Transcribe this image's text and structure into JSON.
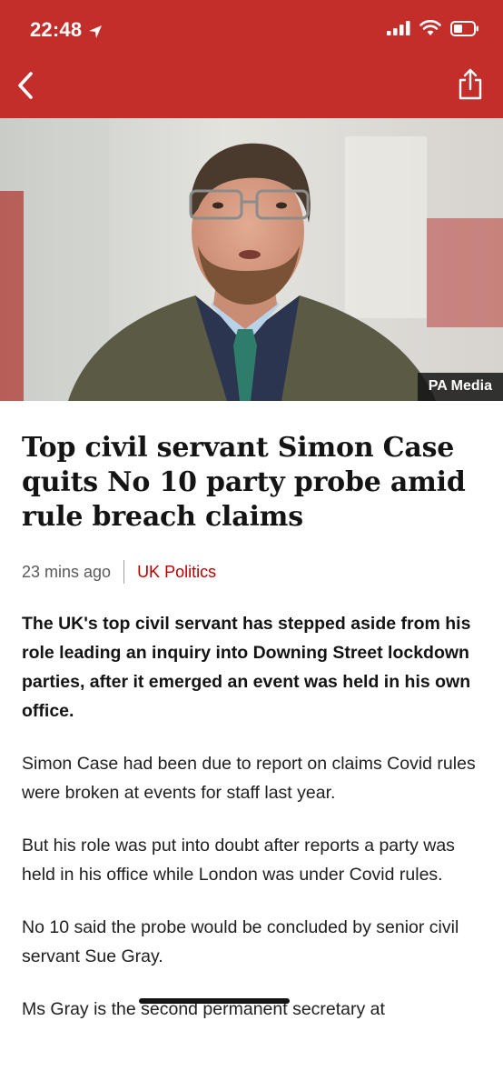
{
  "status_bar": {
    "time": "22:48"
  },
  "nav": {
    "back_icon": "chevron-left-icon",
    "share_icon": "share-icon"
  },
  "hero": {
    "photo_credit": "PA Media"
  },
  "article": {
    "headline": "Top civil servant Simon Case quits No 10 party probe amid rule breach claims",
    "timestamp": "23 mins ago",
    "topic": "UK Politics",
    "lead": "The UK's top civil servant has stepped aside from his role leading an inquiry into Downing Street lockdown parties, after it emerged an event was held in his own office.",
    "paragraphs": [
      "Simon Case had been due to report on claims Covid rules were broken at events for staff last year.",
      "But his role was put into doubt after reports a party was held in his office while London was under Covid rules.",
      "No 10 said the probe would be concluded by senior civil servant Sue Gray."
    ],
    "last_paragraph": {
      "start": "Ms Gray is the ",
      "middle": "second permanent",
      "end": " secretary at"
    }
  },
  "colors": {
    "header_bg": "#c32e2a",
    "topic_link": "#b80000",
    "text": "#141414"
  }
}
